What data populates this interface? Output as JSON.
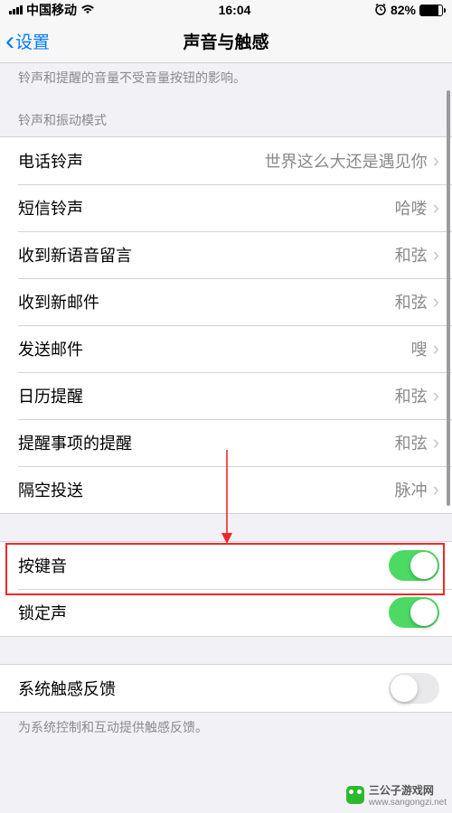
{
  "status": {
    "carrier": "中国移动",
    "time": "16:04",
    "battery_percent": "82%"
  },
  "nav": {
    "back_label": "设置",
    "title": "声音与触感"
  },
  "volume_footer": "铃声和提醒的音量不受音量按钮的影响。",
  "ringtone_section_header": "铃声和振动模式",
  "ringtone_items": [
    {
      "label": "电话铃声",
      "value": "世界这么大还是遇见你"
    },
    {
      "label": "短信铃声",
      "value": "哈喽"
    },
    {
      "label": "收到新语音留言",
      "value": "和弦"
    },
    {
      "label": "收到新邮件",
      "value": "和弦"
    },
    {
      "label": "发送邮件",
      "value": "嗖"
    },
    {
      "label": "日历提醒",
      "value": "和弦"
    },
    {
      "label": "提醒事项的提醒",
      "value": "和弦"
    },
    {
      "label": "隔空投送",
      "value": "脉冲"
    }
  ],
  "switch_items": [
    {
      "label": "按键音",
      "on": true
    },
    {
      "label": "锁定声",
      "on": true
    }
  ],
  "haptic": {
    "label": "系统触感反馈",
    "on": false,
    "footer": "为系统控制和互动提供触感反馈。"
  },
  "watermark": {
    "text": "三公子游戏网",
    "url": "www.sangongzi.net"
  }
}
